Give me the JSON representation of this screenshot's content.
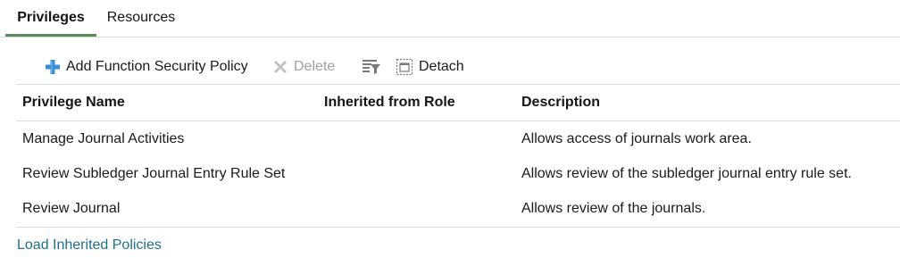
{
  "tabs": [
    {
      "label": "Privileges",
      "active": true
    },
    {
      "label": "Resources",
      "active": false
    }
  ],
  "toolbar": {
    "add_label": "Add Function Security Policy",
    "delete_label": "Delete",
    "detach_label": "Detach",
    "add_icon": "plus-icon",
    "delete_icon": "x-icon",
    "filter_icon": "query-by-example-icon",
    "detach_icon": "detach-icon"
  },
  "table": {
    "headers": [
      "Privilege Name",
      "Inherited from Role",
      "Description"
    ],
    "rows": [
      {
        "name": "Manage Journal Activities",
        "inherited": "",
        "description": "Allows access of journals work area."
      },
      {
        "name": "Review Subledger Journal Entry Rule Set",
        "inherited": "",
        "description": "Allows review of the subledger journal entry rule set."
      },
      {
        "name": "Review Journal",
        "inherited": "",
        "description": "Allows review of the journals."
      }
    ]
  },
  "footer": {
    "load_link": "Load Inherited Policies"
  },
  "colors": {
    "active_tab_underline": "#5c8b5a",
    "add_icon": "#3a8fd6",
    "link": "#1f6f8b",
    "disabled": "#a0a0a0"
  }
}
